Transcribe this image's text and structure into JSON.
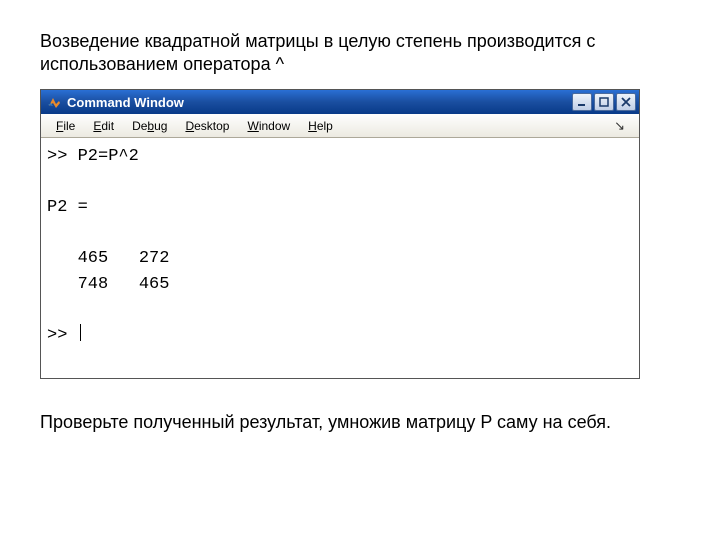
{
  "caption_top": "Возведение квадратной матрицы в целую степень производится с использованием оператора ^",
  "window": {
    "title": "Command Window"
  },
  "menu": {
    "file": "File",
    "edit": "Edit",
    "debug": "Debug",
    "desktop": "Desktop",
    "window": "Window",
    "help": "Help",
    "glyph": "↘"
  },
  "console": {
    "prompt1": ">> P2=P^2",
    "blank": "",
    "result_label": "P2 =",
    "row1": "   465   272",
    "row2": "   748   465",
    "prompt2": ">> "
  },
  "caption_bottom": "Проверьте полученный результат, умножив матрицу P саму на себя."
}
